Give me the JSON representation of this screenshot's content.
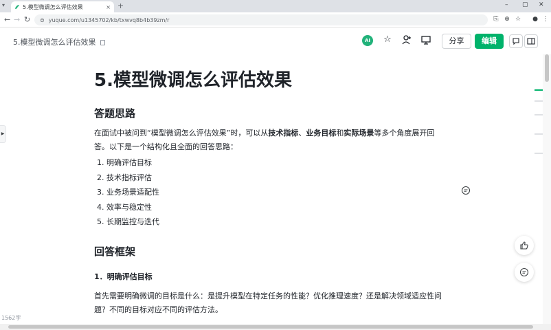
{
  "browser": {
    "tab_title": "5.模型微调怎么评估效果",
    "url": "yuque.com/u1345702/kb/txwvq8b4b39zm/r",
    "tab_close": "×",
    "new_tab": "+",
    "win_min": "–",
    "win_max": "▢",
    "win_close": "✕"
  },
  "header": {
    "doc_title": "5.模型微调怎么评估效果",
    "ai_label": "AI",
    "share_label": "分享",
    "edit_label": "编辑"
  },
  "content": {
    "title": "5.模型微调怎么评估效果",
    "section1_heading": "答题思路",
    "intro": {
      "prefix": "在面试中被问到“模型微调怎么评估效果”时，可以从",
      "b1": "技术指标",
      "sep1": "、",
      "b2": "业务目标",
      "sep2": "和",
      "b3": "实际场景",
      "suffix": "等多个角度展开回答。以下是一个结构化且全面的回答思路："
    },
    "list": [
      {
        "num": "1.",
        "text": "明确评估目标"
      },
      {
        "num": "2.",
        "text": "技术指标评估"
      },
      {
        "num": "3.",
        "text": "业务场景适配性"
      },
      {
        "num": "4.",
        "text": "效率与稳定性"
      },
      {
        "num": "5.",
        "text": "长期监控与迭代"
      }
    ],
    "section2_heading": "回答框架",
    "sub_heading": "1．明确评估目标",
    "para2": "首先需要明确微调的目标是什么：是提升模型在特定任务的性能？优化推理速度？还是解决领域适应性问题？不同的目标对应不同的评估方法。"
  },
  "footer": {
    "word_count": "1562字"
  },
  "colors": {
    "accent": "#00b36b",
    "text": "#1f2329"
  }
}
